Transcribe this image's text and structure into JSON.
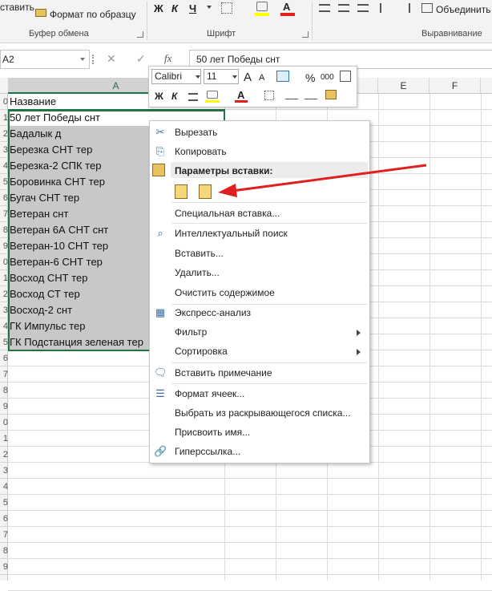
{
  "ribbon": {
    "paste_label": "ставить",
    "format_painter_label": "Формат по образцу",
    "clipboard_group": "Буфер обмена",
    "font_group": "Шрифт",
    "alignment_group": "Выравнивание",
    "bold": "Ж",
    "italic": "К",
    "underline": "Ч",
    "font_color_glyph": "A",
    "merge_label": "Объединить"
  },
  "formula_bar": {
    "name_box": "A2",
    "cancel": "✕",
    "enter": "✓",
    "fx": "fx",
    "content": "50 лет Победы снт"
  },
  "columns": [
    "A",
    "E",
    "F"
  ],
  "rows": [
    "0",
    "1",
    "2",
    "3",
    "4",
    "5",
    "6",
    "7",
    "8",
    "9",
    "0",
    "1",
    "2",
    "3",
    "4",
    "5",
    "6",
    "7",
    "8",
    "9",
    "0",
    "1",
    "2",
    "3",
    "4",
    "5",
    "6",
    "7",
    "8",
    "9"
  ],
  "cells": [
    "Название",
    "50 лет Победы снт",
    "Бадалык д",
    "Березка СНТ тер",
    "Березка-2 СПК тер",
    "Боровинка СНТ тер",
    "Бугач СНТ тер",
    "Ветеран снт",
    "Ветеран 6А СНТ снт",
    "Ветеран-10 СНТ тер",
    "Ветеран-6 СНТ тер",
    "Восход СНТ тер",
    "Восход СТ тер",
    "Восход-2 снт",
    "ГК Импульс тер",
    "ГК Подстанция зеленая тер"
  ],
  "mini_toolbar": {
    "font": "Calibri",
    "size": "11",
    "grow": "A",
    "shrink": "A",
    "percent": "%",
    "thousands": "000",
    "bold": "Ж",
    "italic": "К",
    "font_color": "A"
  },
  "context_menu": {
    "cut": "Вырезать",
    "copy": "Копировать",
    "paste_options": "Параметры вставки:",
    "paste_special": "Специальная вставка...",
    "smart_lookup": "Интеллектуальный поиск",
    "insert": "Вставить...",
    "delete": "Удалить...",
    "clear": "Очистить содержимое",
    "quick_analysis": "Экспресс-анализ",
    "filter": "Фильтр",
    "sort": "Сортировка",
    "insert_comment": "Вставить примечание",
    "format_cells": "Формат ячеек...",
    "pick_list": "Выбрать из раскрывающегося списка...",
    "define_name": "Присвоить имя...",
    "hyperlink": "Гиперссылка..."
  },
  "colors": {
    "accent_green": "#217346",
    "arrow_red": "#e0201e",
    "selection_gray": "#c8c8c8"
  }
}
